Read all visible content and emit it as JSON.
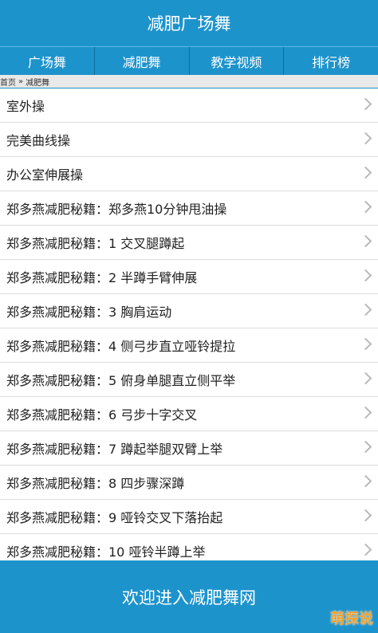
{
  "header": {
    "title": "减肥广场舞"
  },
  "nav": {
    "tabs": [
      {
        "label": "广场舞"
      },
      {
        "label": "减肥舞"
      },
      {
        "label": "教学视频"
      },
      {
        "label": "排行榜"
      }
    ]
  },
  "breadcrumb": {
    "home": "首页",
    "separator": "»",
    "current": "减肥舞"
  },
  "list": {
    "items": [
      {
        "label": "室外操"
      },
      {
        "label": "完美曲线操"
      },
      {
        "label": "办公室伸展操"
      },
      {
        "label": "郑多燕减肥秘籍：郑多燕10分钟甩油操"
      },
      {
        "label": "郑多燕减肥秘籍：1 交叉腿蹲起"
      },
      {
        "label": "郑多燕减肥秘籍：2 半蹲手臂伸展"
      },
      {
        "label": "郑多燕减肥秘籍：3 胸肩运动"
      },
      {
        "label": "郑多燕减肥秘籍：4 侧弓步直立哑铃提拉"
      },
      {
        "label": "郑多燕减肥秘籍：5 俯身单腿直立侧平举"
      },
      {
        "label": "郑多燕减肥秘籍：6 弓步十字交叉"
      },
      {
        "label": "郑多燕减肥秘籍：7 蹲起举腿双臂上举"
      },
      {
        "label": "郑多燕减肥秘籍：8 四步骤深蹲"
      },
      {
        "label": "郑多燕减肥秘籍：9 哑铃交叉下落抬起"
      },
      {
        "label": "郑多燕减肥秘籍：10 哑铃半蹲上举"
      }
    ]
  },
  "footer": {
    "text": "欢迎进入减肥舞网"
  },
  "watermark": {
    "text": "萌探说"
  },
  "colors": {
    "brand": "#1d93cc",
    "divider": "#dcdcdc",
    "chevron": "#b8b8b8"
  }
}
